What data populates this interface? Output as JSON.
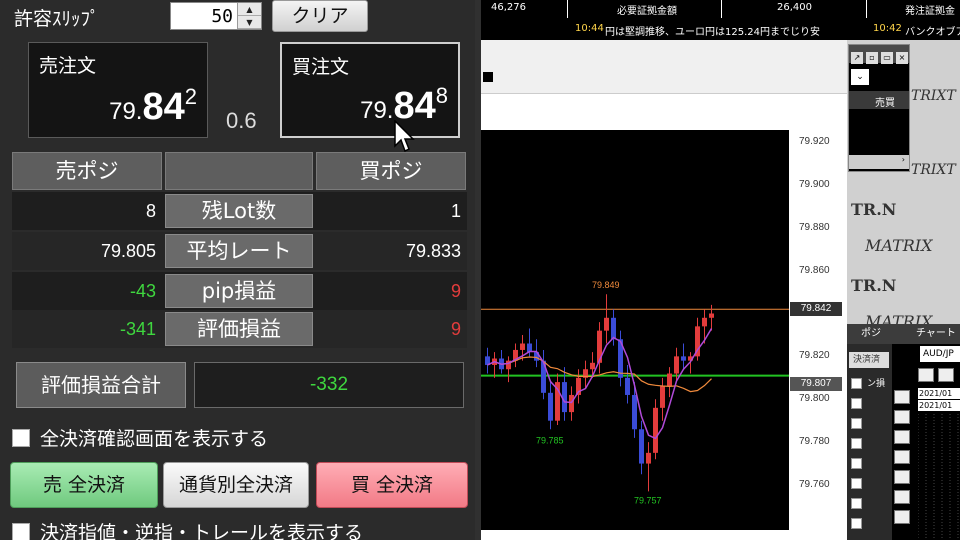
{
  "slippage": {
    "label": "許容ｽﾘｯﾌﾟ",
    "value": "50",
    "up": "▲",
    "down": "▼",
    "clear_label": "クリア"
  },
  "quotes": {
    "sell": {
      "title": "売注文",
      "prefix": "79.",
      "big": "84",
      "sup": "2"
    },
    "buy": {
      "title": "買注文",
      "prefix": "79.",
      "big": "84",
      "sup": "8"
    },
    "spread": "0.6"
  },
  "positions": {
    "headers": {
      "sell": "売ポジ",
      "middle": "",
      "buy": "買ポジ"
    },
    "rows": [
      {
        "label": "残Lot数",
        "sell": "8",
        "buy": "1",
        "sell_color": "white",
        "buy_color": "white"
      },
      {
        "label": "平均レート",
        "sell": "79.805",
        "buy": "79.833",
        "sell_color": "white",
        "buy_color": "white"
      },
      {
        "label": "pip損益",
        "sell": "-43",
        "buy": "9",
        "sell_color": "green",
        "buy_color": "red"
      },
      {
        "label": "評価損益",
        "sell": "-341",
        "buy": "9",
        "sell_color": "green",
        "buy_color": "red"
      }
    ]
  },
  "total": {
    "label": "評価損益合計",
    "value": "-332"
  },
  "checkbox1": "全決済確認画面を表示する",
  "actions": {
    "sell_all": "売 全決済",
    "currency_all": "通貨別全決済",
    "buy_all": "買 全決済"
  },
  "checkbox2": "決済指値・逆指・トレールを表示する",
  "ticker": {
    "cells": [
      "46,276",
      "必要証拠金額",
      "26,400",
      "発注証拠金"
    ],
    "news1_time": "10:44",
    "news1": "円は堅調推移、ユーロ円は125.24円までじり安",
    "news2_time": "10:42",
    "news2": "バンクオブアメ"
  },
  "chart": {
    "y_ticks": [
      "79.920",
      "79.900",
      "79.880",
      "79.860",
      "79.842",
      "79.820",
      "79.807",
      "79.800",
      "79.780",
      "79.760"
    ],
    "ask_tag": "79.842",
    "bid_tag": "79.807",
    "annotations": {
      "high": "79.849",
      "low1": "79.785",
      "low2": "79.757"
    },
    "colors": {
      "up": "#e23c3c",
      "down": "#3b4cd8",
      "ask_line": "#f08a3c",
      "bid_line": "#22c322",
      "ma_fast": "#b04ad8",
      "ma_slow": "#f08a3c"
    }
  },
  "right": {
    "mini_col": "売買",
    "mini_btns": [
      "↗",
      "▫",
      "▭",
      "×"
    ],
    "ads": [
      "TRIXT",
      "TRIXT",
      "TR.N",
      "MATRIX",
      "TR.N",
      "MATRIX"
    ],
    "pos_title": "ポジ",
    "pos_label": "決済済",
    "pos_label2": "ン損",
    "chart_title": "チャート",
    "symbol": "AUD/JP",
    "dates": [
      "2021/01",
      "2021/01"
    ]
  }
}
